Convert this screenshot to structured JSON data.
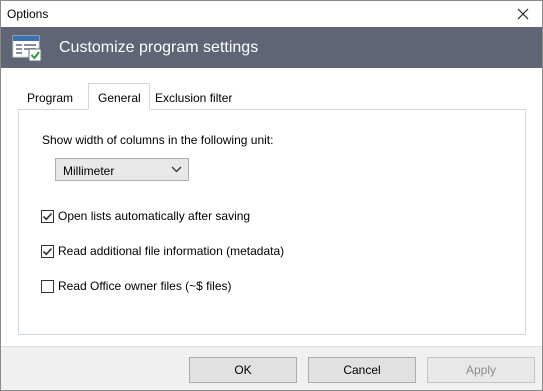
{
  "window": {
    "title": "Options"
  },
  "header": {
    "title": "Customize program settings"
  },
  "tabs": [
    {
      "label": "Program"
    },
    {
      "label": "General",
      "active": true
    },
    {
      "label": "Exclusion filter"
    }
  ],
  "general": {
    "unit_label": "Show width of columns in the following unit:",
    "unit_select": {
      "value": "Millimeter"
    },
    "options": [
      {
        "label": "Open lists automatically after saving",
        "checked": true
      },
      {
        "label": "Read additional file information (metadata)",
        "checked": true
      },
      {
        "label": "Read Office owner files (~$ files)",
        "checked": false
      }
    ]
  },
  "buttons": {
    "ok": "OK",
    "cancel": "Cancel",
    "apply": "Apply"
  },
  "colors": {
    "header_bg": "#5f6575",
    "tab_border": "#cfd8de",
    "check_color": "#333333"
  }
}
